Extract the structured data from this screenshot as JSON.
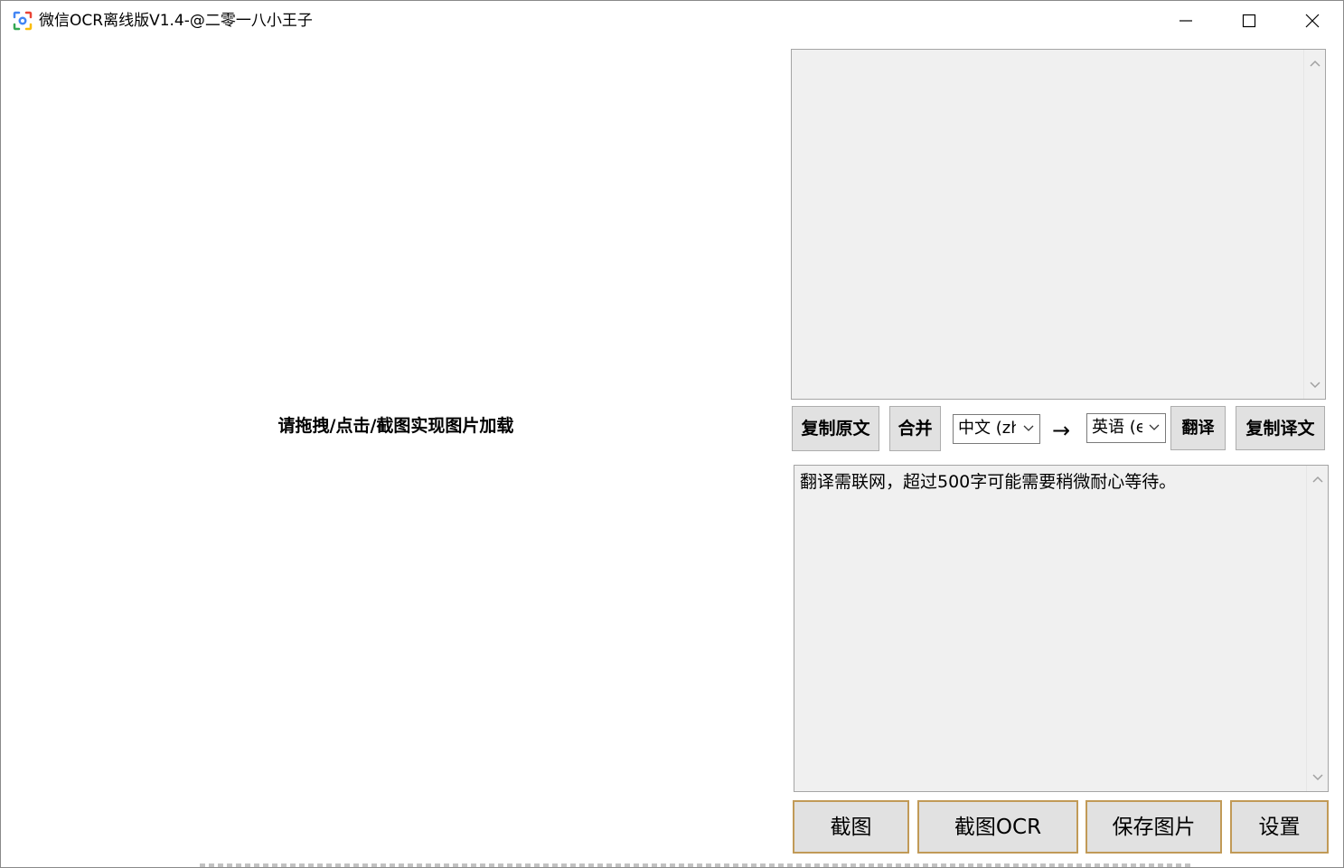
{
  "window": {
    "title": "微信OCR离线版V1.4-@二零一八小王子",
    "icon": "ocr-app-icon",
    "controls": [
      "minimize-icon",
      "maximize-icon",
      "close-icon"
    ]
  },
  "dropzone": {
    "hint": "请拖拽/点击/截图实现图片加载"
  },
  "ocr_output": {
    "text": ""
  },
  "toolbar": {
    "copy_original_label": "复制原文",
    "merge_label": "合并",
    "source_lang": "中文 (zh",
    "arrow": "→",
    "target_lang": "英语 (e",
    "translate_label": "翻译",
    "copy_translation_label": "复制译文"
  },
  "translation_output": {
    "text": "翻译需联网，超过500字可能需要稍微耐心等待。"
  },
  "bottom_bar": {
    "screenshot_label": "截图",
    "screenshot_ocr_label": "截图OCR",
    "save_image_label": "保存图片",
    "settings_label": "设置"
  },
  "colors": {
    "textarea_bg": "#f0f0f0",
    "button_bg": "#e1e1e1",
    "accent_border": "#c19a57"
  }
}
